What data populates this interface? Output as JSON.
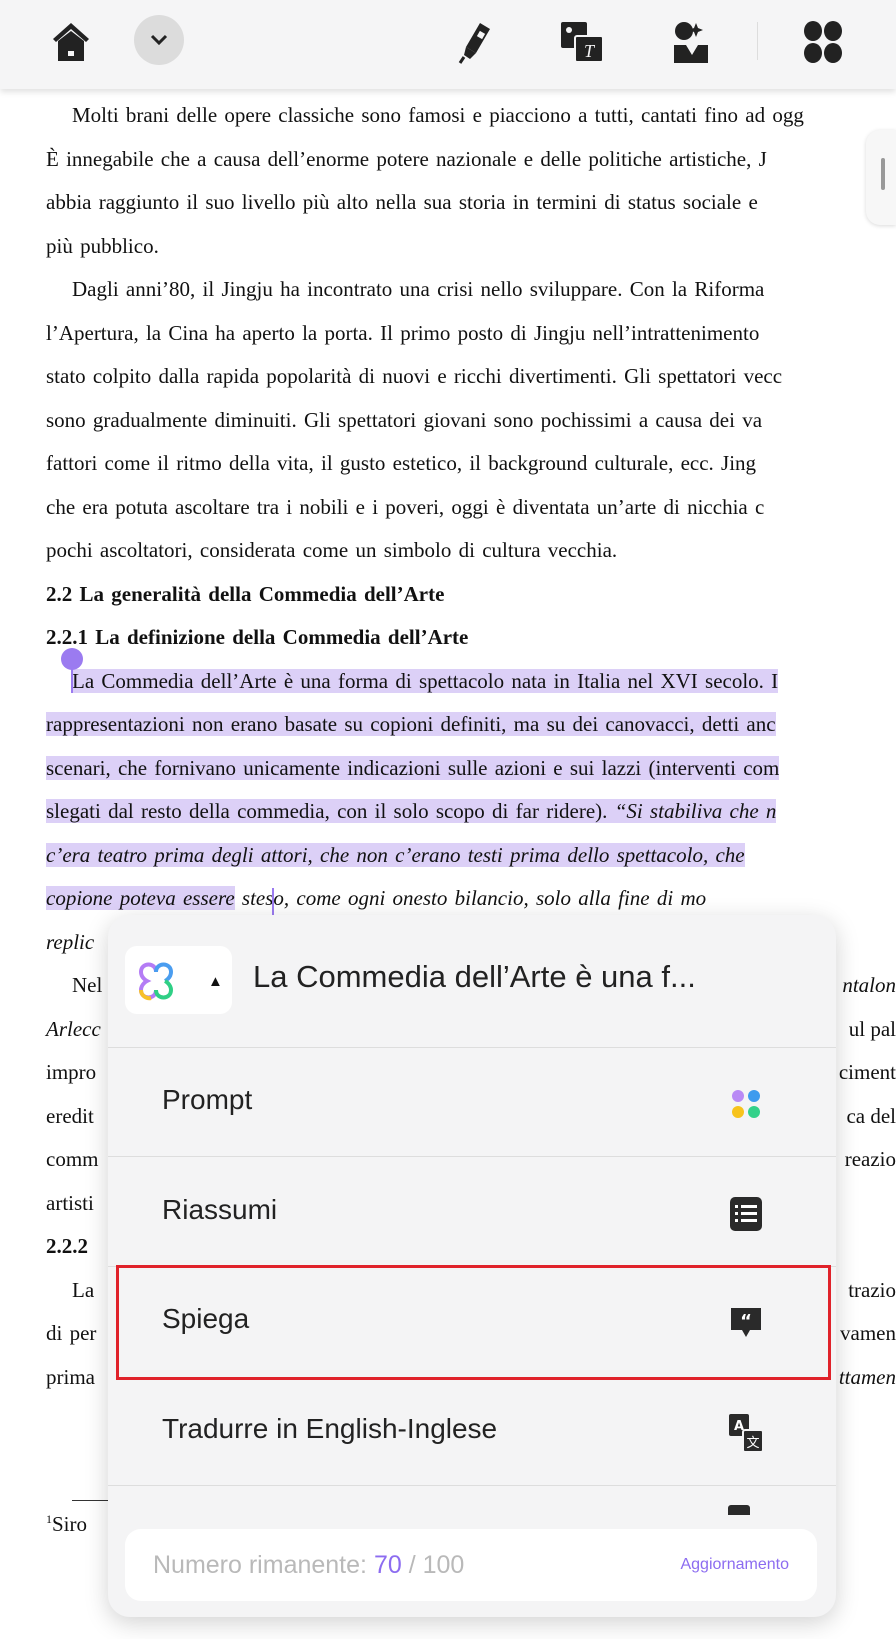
{
  "toolbar": {
    "icons": [
      "home-icon",
      "chevron-down-icon",
      "highlighter-icon",
      "image-to-text-icon",
      "ai-avatar-icon",
      "apps-grid-icon"
    ]
  },
  "document": {
    "lines": [
      "Molti brani delle opere classiche sono famosi e piacciono a tutti, cantati fino ad ogg",
      "È innegabile che a causa dell’enorme potere nazionale e delle politiche artistiche, J",
      "abbia raggiunto il suo livello più alto nella sua storia in termini di status sociale e",
      "più pubblico.",
      "Dagli anni’80, il Jingju ha incontrato una crisi nello sviluppare. Con la Riforma",
      "l’Apertura, la Cina ha aperto la porta. Il primo posto di Jingju nell’intrattenimento",
      "stato colpito dalla rapida popolarità di nuovi e ricchi divertimenti. Gli spettatori vecc",
      "sono gradualmente diminuiti. Gli spettatori giovani sono pochissimi a causa dei va",
      "fattori come il ritmo della vita, il gusto estetico, il background culturale, ecc. Jing",
      "che era potuta ascoltare tra i nobili e i poveri, oggi è diventata un’arte di nicchia c",
      "pochi ascoltatori, considerata come un simbolo di cultura vecchia."
    ],
    "heading1": "2.2 La generalità della Commedia dell’Arte",
    "heading2": "2.2.1 La definizione della Commedia dell’Arte",
    "selected": {
      "l1": "La Commedia dell’Arte è una forma di spettacolo nata in Italia nel XVI secolo. I",
      "l2": "rappresentazioni non erano basate su copioni definiti, ma su dei canovacci, detti anc",
      "l3": "scenari, che fornivano unicamente indicazioni sulle azioni e sui lazzi (interventi com",
      "l4a": "slegati dal resto della commedia, con il solo scopo di far ridere). ",
      "l4b": "“Si stabiliva che n",
      "l5": "c’era teatro prima degli attori, che non c’erano testi prima dello spettacolo, che",
      "l6a": "copione poteva essere",
      "l6b": " steso, come ogni onesto bilancio, solo alla fine di mo"
    },
    "partial": [
      {
        "left": "replic",
        "right": ""
      },
      {
        "left": "Nel",
        "right": "ntalon"
      },
      {
        "left": "Arlecc",
        "right": "ul pal"
      },
      {
        "left": "impro",
        "right": "ciment"
      },
      {
        "left": "eredit",
        "right": "ca del"
      },
      {
        "left": "comm",
        "right": "reazio"
      },
      {
        "left": "artisti",
        "right": ""
      },
      {
        "left": "2.2.2",
        "right": ""
      },
      {
        "left": "La",
        "right": "trazio"
      },
      {
        "left": "di per",
        "right": "vamen"
      },
      {
        "left": "prima",
        "right": "ttamen"
      }
    ],
    "footnote": "Siro",
    "footnote_mark": "1"
  },
  "ai_menu": {
    "title": "La Commedia dell’Arte è una f...",
    "collapse_glyph": "▲",
    "items": [
      {
        "label": "Prompt",
        "icon": "four-dots-icon"
      },
      {
        "label": "Riassumi",
        "icon": "list-icon"
      },
      {
        "label": "Spiega",
        "icon": "quote-bubble-icon"
      },
      {
        "label": "Tradurre in English-Inglese",
        "icon": "translate-icon"
      }
    ],
    "footer": {
      "label": "Numero rimanente: ",
      "remaining": "70",
      "separator": " / ",
      "total": "100",
      "upgrade": "Aggiornamento"
    },
    "colors": {
      "accent": "#8c6cf0",
      "highlight": "#e0222a",
      "selection": "#dcd0f7"
    }
  }
}
